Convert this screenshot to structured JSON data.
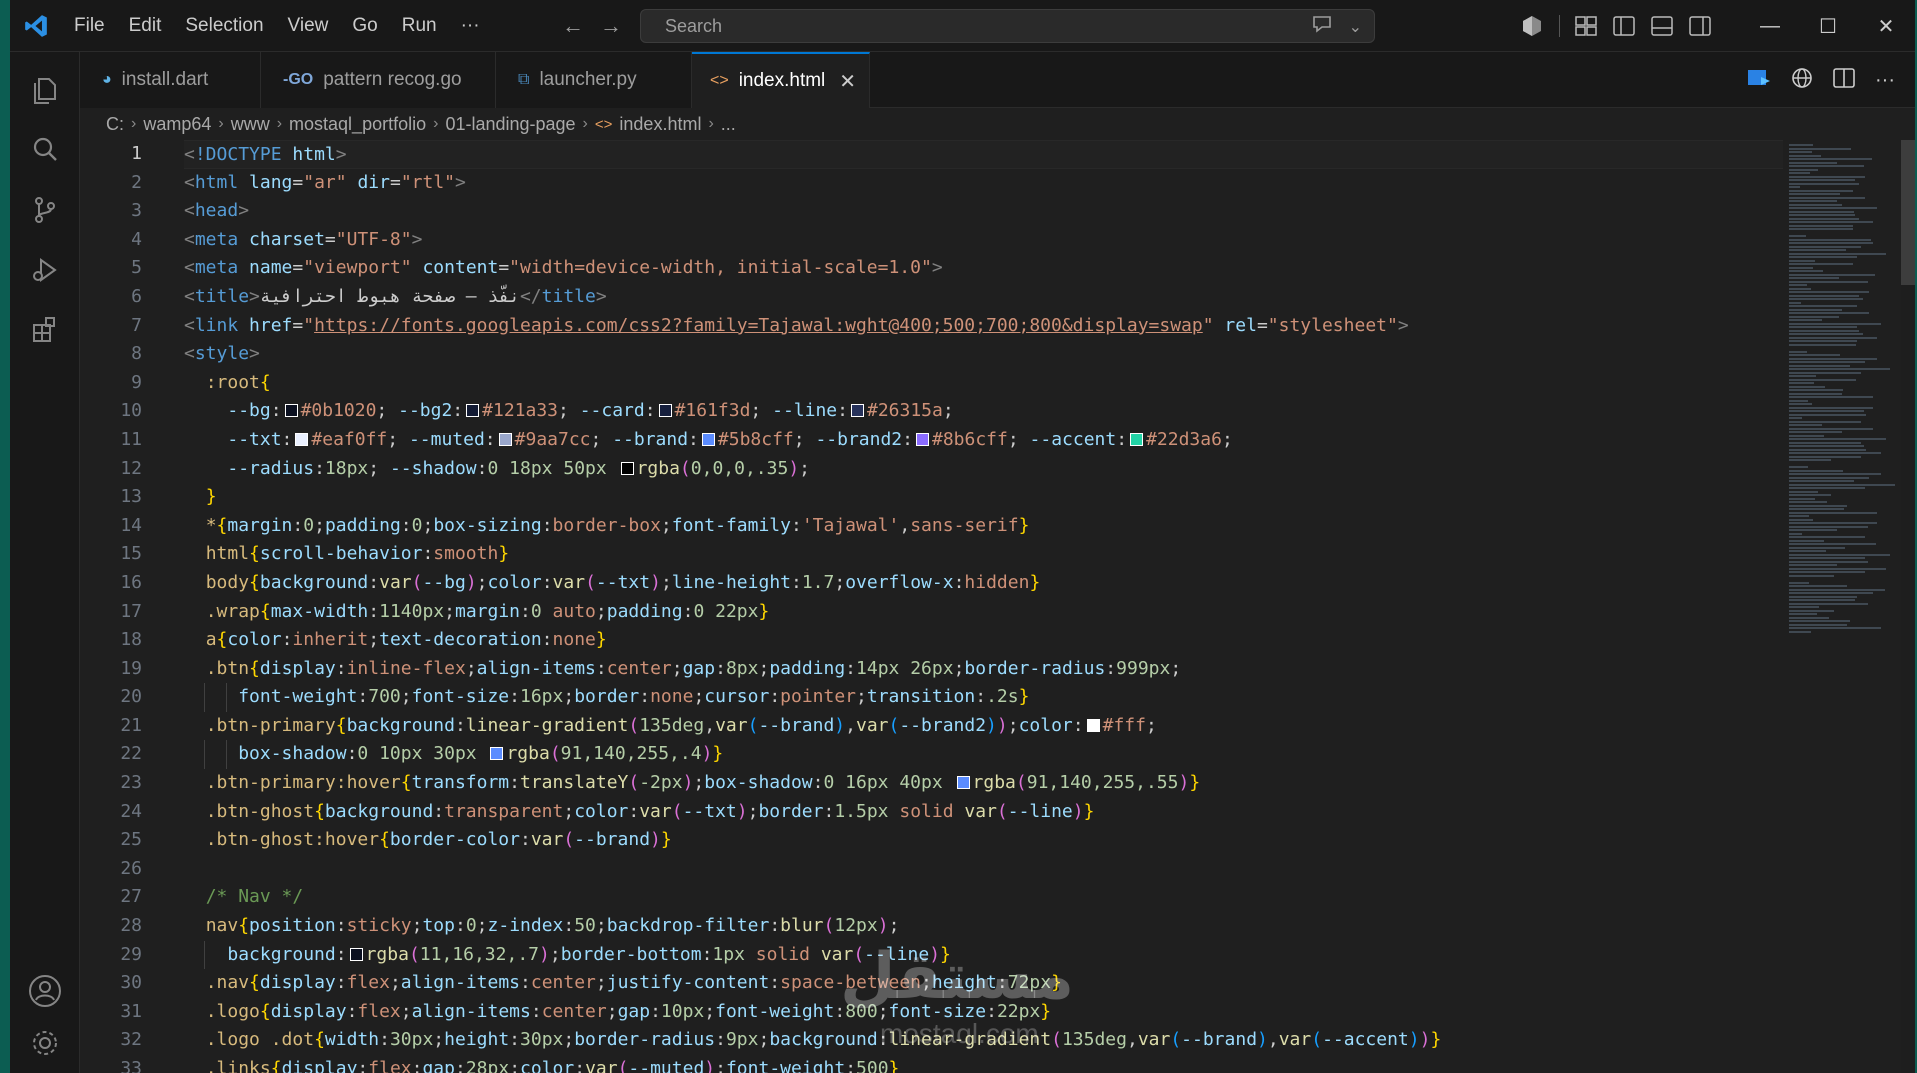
{
  "menu": [
    "File",
    "Edit",
    "Selection",
    "View",
    "Go",
    "Run",
    "···"
  ],
  "search": {
    "placeholder": "Search"
  },
  "tabs": [
    {
      "label": "install.dart",
      "icon": "dart-icon"
    },
    {
      "label": "pattern recog.go",
      "icon": "go-icon"
    },
    {
      "label": "launcher.py",
      "icon": "python-icon"
    },
    {
      "label": "index.html",
      "icon": "html-icon",
      "active": true
    }
  ],
  "breadcrumb": [
    "C:",
    "wamp64",
    "www",
    "mostaql_portfolio",
    "01-landing-page",
    "index.html",
    "..."
  ],
  "line_numbers": [
    "1",
    "2",
    "3",
    "4",
    "5",
    "6",
    "7",
    "8",
    "9",
    "10",
    "11",
    "12",
    "13",
    "14",
    "15",
    "16",
    "17",
    "18",
    "19",
    "20",
    "21",
    "22",
    "23",
    "24",
    "25",
    "26",
    "27",
    "28",
    "29",
    "30",
    "31",
    "32",
    "33"
  ],
  "code": {
    "l6_title": "نفّذ — صفحة هبوط احترافية",
    "l7_url": "https://fonts.googleapis.com/css2?family=Tajawal:wght@400;500;700;800&display=swap"
  },
  "swatches": {
    "bg": "#0b1020",
    "bg2": "#121a33",
    "card": "#161f3d",
    "line": "#26315a",
    "txt": "#eaf0ff",
    "muted": "#9aa7cc",
    "brand": "#5b8cff",
    "brand2": "#8b6cff",
    "accent": "#22d3a6",
    "shadow": "#000000",
    "white": "#ffffff",
    "brand_rgba": "#5b8cff",
    "nav_rgba": "#0b1020"
  },
  "watermark": {
    "main": "مستقل",
    "sub": "mostaql.com"
  }
}
